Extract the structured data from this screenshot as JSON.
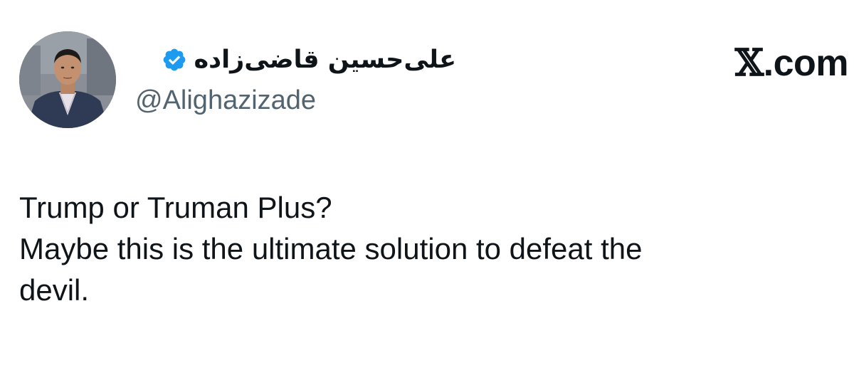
{
  "author": {
    "display_name": "علی‌حسین قاضی‌زاده",
    "handle": "@Alighazizade",
    "verified": true,
    "avatar": "user-avatar"
  },
  "source": {
    "site_label": ".com",
    "site_prefix": "𝕏"
  },
  "tweet": {
    "lines": [
      "Trump or Truman Plus?",
      "Maybe this is the ultimate solution to defeat the",
      "devil."
    ]
  },
  "colors": {
    "text": "#0f1419",
    "secondary_text": "#536471",
    "verified_blue": "#1d9bf0",
    "background": "#ffffff"
  }
}
